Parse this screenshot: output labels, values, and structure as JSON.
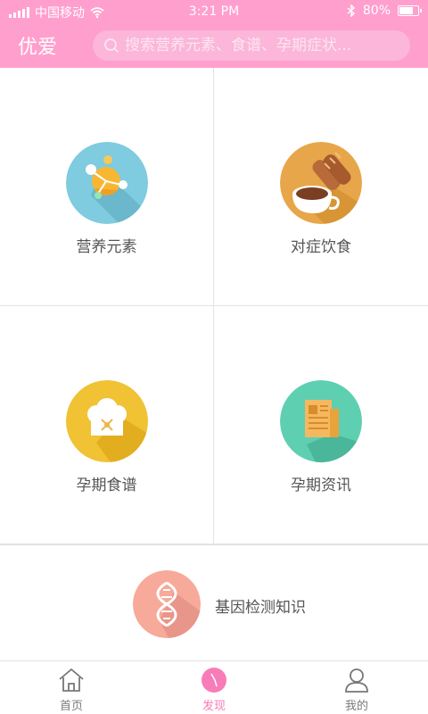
{
  "status_bar": {
    "carrier": "中国移动",
    "time": "3:21 PM",
    "battery": "80%",
    "battery_level": 0.8
  },
  "header": {
    "title": "优爱",
    "search_placeholder": "搜索营养元素、食谱、孕期症状..."
  },
  "grid": [
    {
      "label": "营养元素",
      "icon": "nutrition-molecule-icon",
      "color": "#7fcbe0"
    },
    {
      "label": "对症饮食",
      "icon": "bread-coffee-icon",
      "color": "#e8a64a"
    },
    {
      "label": "孕期食谱",
      "icon": "chef-hat-icon",
      "color": "#f0c234"
    },
    {
      "label": "孕期资讯",
      "icon": "newspaper-icon",
      "color": "#5fcfb2"
    }
  ],
  "gene": {
    "label": "基因检测知识",
    "icon": "dna-icon",
    "color": "#f7a99a"
  },
  "tabs": [
    {
      "label": "首页",
      "icon": "home-icon",
      "active": false
    },
    {
      "label": "发现",
      "icon": "discover-icon",
      "active": true
    },
    {
      "label": "我的",
      "icon": "profile-icon",
      "active": false
    }
  ],
  "colors": {
    "brand_pink": "#ff9fce",
    "active_tab": "#f87cb8"
  }
}
